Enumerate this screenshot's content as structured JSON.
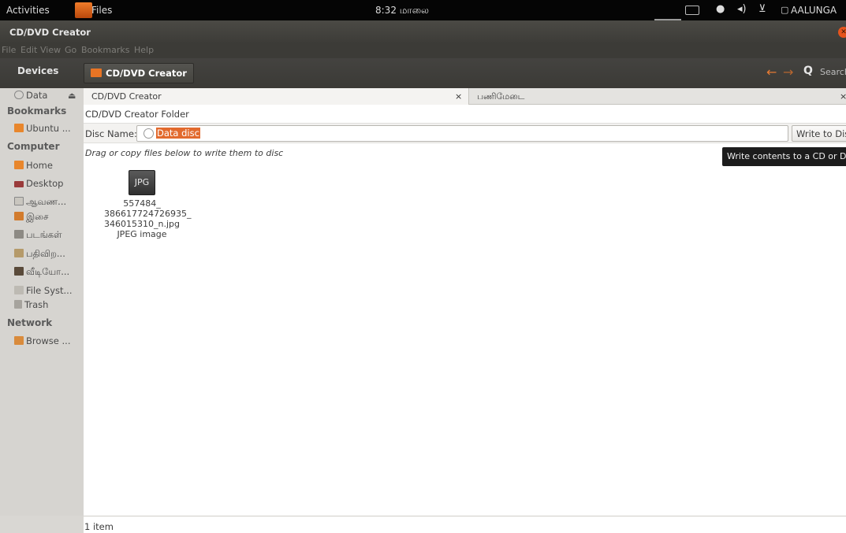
{
  "top_panel": {
    "activities": "Activities",
    "app_name": "Files",
    "clock": "8:32 மாலை",
    "user": "AALUNGA"
  },
  "window": {
    "title": "CD/DVD Creator"
  },
  "menu": [
    "File",
    "Edit",
    "View",
    "Go",
    "Bookmarks",
    "Help"
  ],
  "toolbar": {
    "path_button": "CD/DVD Creator",
    "search_label": "Search"
  },
  "sidebar": {
    "sections": {
      "devices": "Devices",
      "bookmarks": "Bookmarks",
      "computer": "Computer",
      "network": "Network"
    },
    "devices": [
      {
        "label": "Data"
      }
    ],
    "bookmarks": [
      {
        "label": "Ubuntu ..."
      }
    ],
    "computer": [
      {
        "label": "Home"
      },
      {
        "label": "Desktop"
      },
      {
        "label": "ஆவண..."
      },
      {
        "label": "இசை"
      },
      {
        "label": "படங்கள்"
      },
      {
        "label": "பதிவிற..."
      },
      {
        "label": "வீடியோ..."
      },
      {
        "label": "File Syst..."
      },
      {
        "label": "Trash"
      }
    ],
    "network": [
      {
        "label": "Browse ..."
      }
    ]
  },
  "tabs": [
    {
      "label": "CD/DVD Creator",
      "close": "×"
    },
    {
      "label": "பணிமேடை",
      "close": "×"
    }
  ],
  "main": {
    "folder_label": "CD/DVD Creator Folder",
    "disc_name_label": "Disc Name:",
    "disc_name_value": "Data disc",
    "write_button": "Write to Disc",
    "hint": "Drag or copy files below to write them to disc",
    "tooltip": "Write contents to a CD or DVD"
  },
  "file": {
    "thumb_label": "JPG",
    "name_lines": [
      "557484_",
      "386617724726935_",
      "346015310_n.jpg"
    ],
    "type": "JPEG image"
  },
  "status": {
    "count": "1 item"
  },
  "colors": {
    "accent": "#e26a2e",
    "panel": "#050505",
    "sidebar": "#d6d4d0"
  }
}
